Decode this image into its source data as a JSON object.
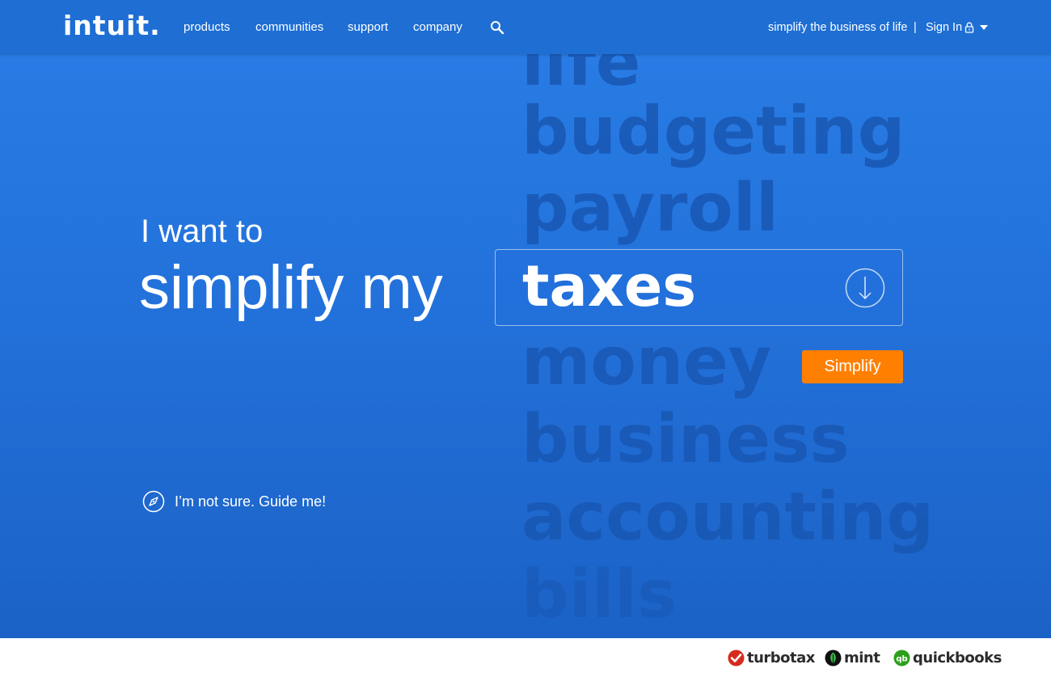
{
  "header": {
    "logo": "intuit.",
    "nav": [
      "products",
      "communities",
      "support",
      "company"
    ],
    "tagline": "simplify the business of life",
    "divider": "|",
    "signin": "Sign In"
  },
  "hero": {
    "line1": "I want to",
    "line2": "simplify my",
    "selected": "taxes",
    "options": [
      "life",
      "budgeting",
      "payroll",
      "taxes",
      "money",
      "business",
      "accounting",
      "bills"
    ],
    "simplify_button": "Simplify",
    "guide": "I’m not sure. Guide me!"
  },
  "footer": {
    "brands": [
      "turbotax",
      "mint",
      "quickbooks"
    ]
  },
  "colors": {
    "background": "#2372dc",
    "header": "#1e6ed4",
    "accent_button": "#ff8000",
    "bg_word": "#1957b3",
    "turbotax_red": "#d52b1e",
    "mint_green": "#1a8a3a",
    "quickbooks_green": "#2ca01c"
  },
  "icons": [
    "search-icon",
    "lock-icon",
    "chevron-down-icon",
    "arrow-down-circle-icon",
    "compass-icon",
    "turbotax-check-icon",
    "mint-leaf-icon",
    "quickbooks-qb-icon"
  ]
}
